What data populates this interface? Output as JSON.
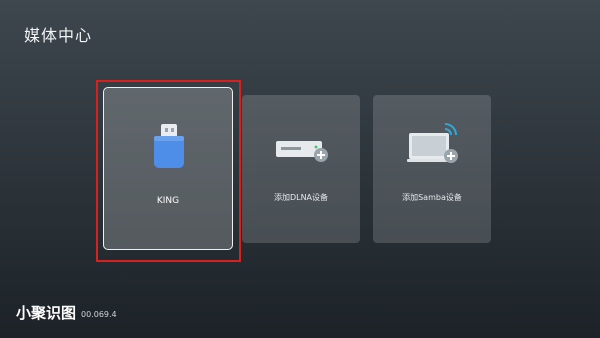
{
  "header": {
    "title": "媒体中心"
  },
  "devices": [
    {
      "label": "KING",
      "icon": "usb-drive-icon",
      "focused": true
    },
    {
      "label": "添加DLNA设备",
      "icon": "add-dlna-device-icon"
    },
    {
      "label": "添加Samba设备",
      "icon": "add-samba-device-icon"
    }
  ],
  "footer": {
    "watermark": "小聚识图",
    "version": "00.069.4"
  },
  "colors": {
    "focus_border": "#d8201e",
    "usb_icon": "#4f8ee8",
    "accent_plus": "#9aa4ab"
  }
}
